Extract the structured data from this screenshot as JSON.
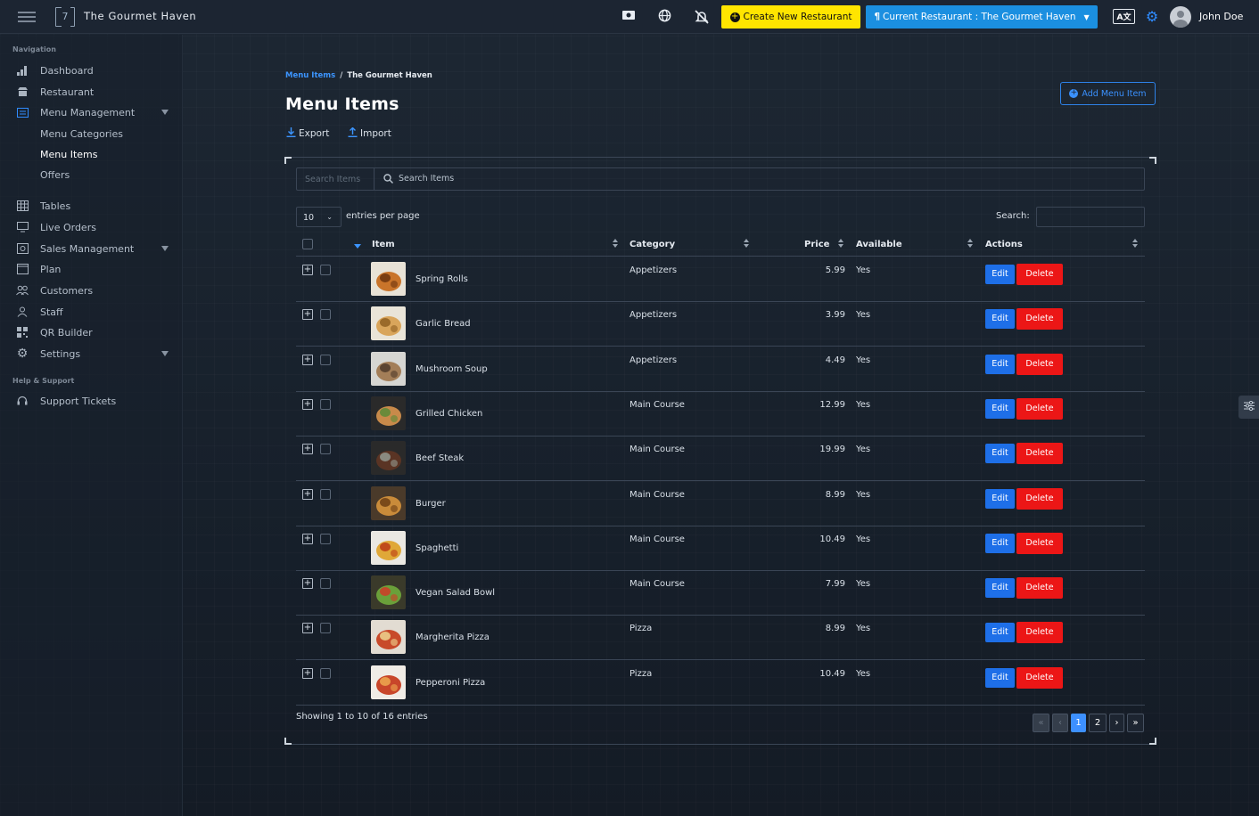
{
  "topbar": {
    "brand": "The Gourmet Haven",
    "logo_text": "7",
    "create_label": "Create New Restaurant",
    "current_label": "Current Restaurant : The Gourmet Haven",
    "lang_label": "A文",
    "user_name": "John Doe",
    "colors": {
      "create_bg": "#ffe500",
      "current_bg": "#1b8fe0"
    }
  },
  "sidebar": {
    "section_nav": "Navigation",
    "section_help": "Help & Support",
    "items": [
      {
        "label": "Dashboard",
        "icon": "bar-chart-icon"
      },
      {
        "label": "Restaurant",
        "icon": "store-icon"
      },
      {
        "label": "Menu Management",
        "icon": "menu-list-icon"
      },
      {
        "label": "Menu Categories"
      },
      {
        "label": "Menu Items"
      },
      {
        "label": "Offers"
      },
      {
        "label": "Tables",
        "icon": "table-icon"
      },
      {
        "label": "Live Orders",
        "icon": "monitor-icon"
      },
      {
        "label": "Sales Management",
        "icon": "sales-icon"
      },
      {
        "label": "Plan",
        "icon": "window-icon"
      },
      {
        "label": "Customers",
        "icon": "users-icon"
      },
      {
        "label": "Staff",
        "icon": "user-icon"
      },
      {
        "label": "QR Builder",
        "icon": "qr-icon"
      },
      {
        "label": "Settings",
        "icon": "gear-icon"
      },
      {
        "label": "Support Tickets",
        "icon": "headset-icon"
      }
    ]
  },
  "page": {
    "crumb_link": "Menu Items",
    "crumb_sep": "/",
    "crumb_current": "The Gourmet Haven",
    "title": "Menu Items",
    "add_label": "Add Menu Item",
    "export_label": "Export",
    "import_label": "Import"
  },
  "table": {
    "search_placeholder": "Search Items",
    "search_label": "Search Items",
    "page_size": "10",
    "entries_label": "entries per page",
    "search_text": "Search:",
    "columns": [
      "Item",
      "Category",
      "Price",
      "Available",
      "Actions"
    ],
    "edit_label": "Edit",
    "delete_label": "Delete",
    "rows": [
      {
        "name": "Spring Rolls",
        "category": "Appetizers",
        "price": "5.99",
        "available": "Yes"
      },
      {
        "name": "Garlic Bread",
        "category": "Appetizers",
        "price": "3.99",
        "available": "Yes"
      },
      {
        "name": "Mushroom Soup",
        "category": "Appetizers",
        "price": "4.49",
        "available": "Yes"
      },
      {
        "name": "Grilled Chicken",
        "category": "Main Course",
        "price": "12.99",
        "available": "Yes"
      },
      {
        "name": "Beef Steak",
        "category": "Main Course",
        "price": "19.99",
        "available": "Yes"
      },
      {
        "name": "Burger",
        "category": "Main Course",
        "price": "8.99",
        "available": "Yes"
      },
      {
        "name": "Spaghetti",
        "category": "Main Course",
        "price": "10.49",
        "available": "Yes"
      },
      {
        "name": "Vegan Salad Bowl",
        "category": "Main Course",
        "price": "7.99",
        "available": "Yes"
      },
      {
        "name": "Margherita Pizza",
        "category": "Pizza",
        "price": "8.99",
        "available": "Yes"
      },
      {
        "name": "Pepperoni Pizza",
        "category": "Pizza",
        "price": "10.49",
        "available": "Yes"
      }
    ],
    "info": "Showing 1 to 10 of 16 entries",
    "pages": [
      "«",
      "‹",
      "1",
      "2",
      "›",
      "»"
    ]
  }
}
